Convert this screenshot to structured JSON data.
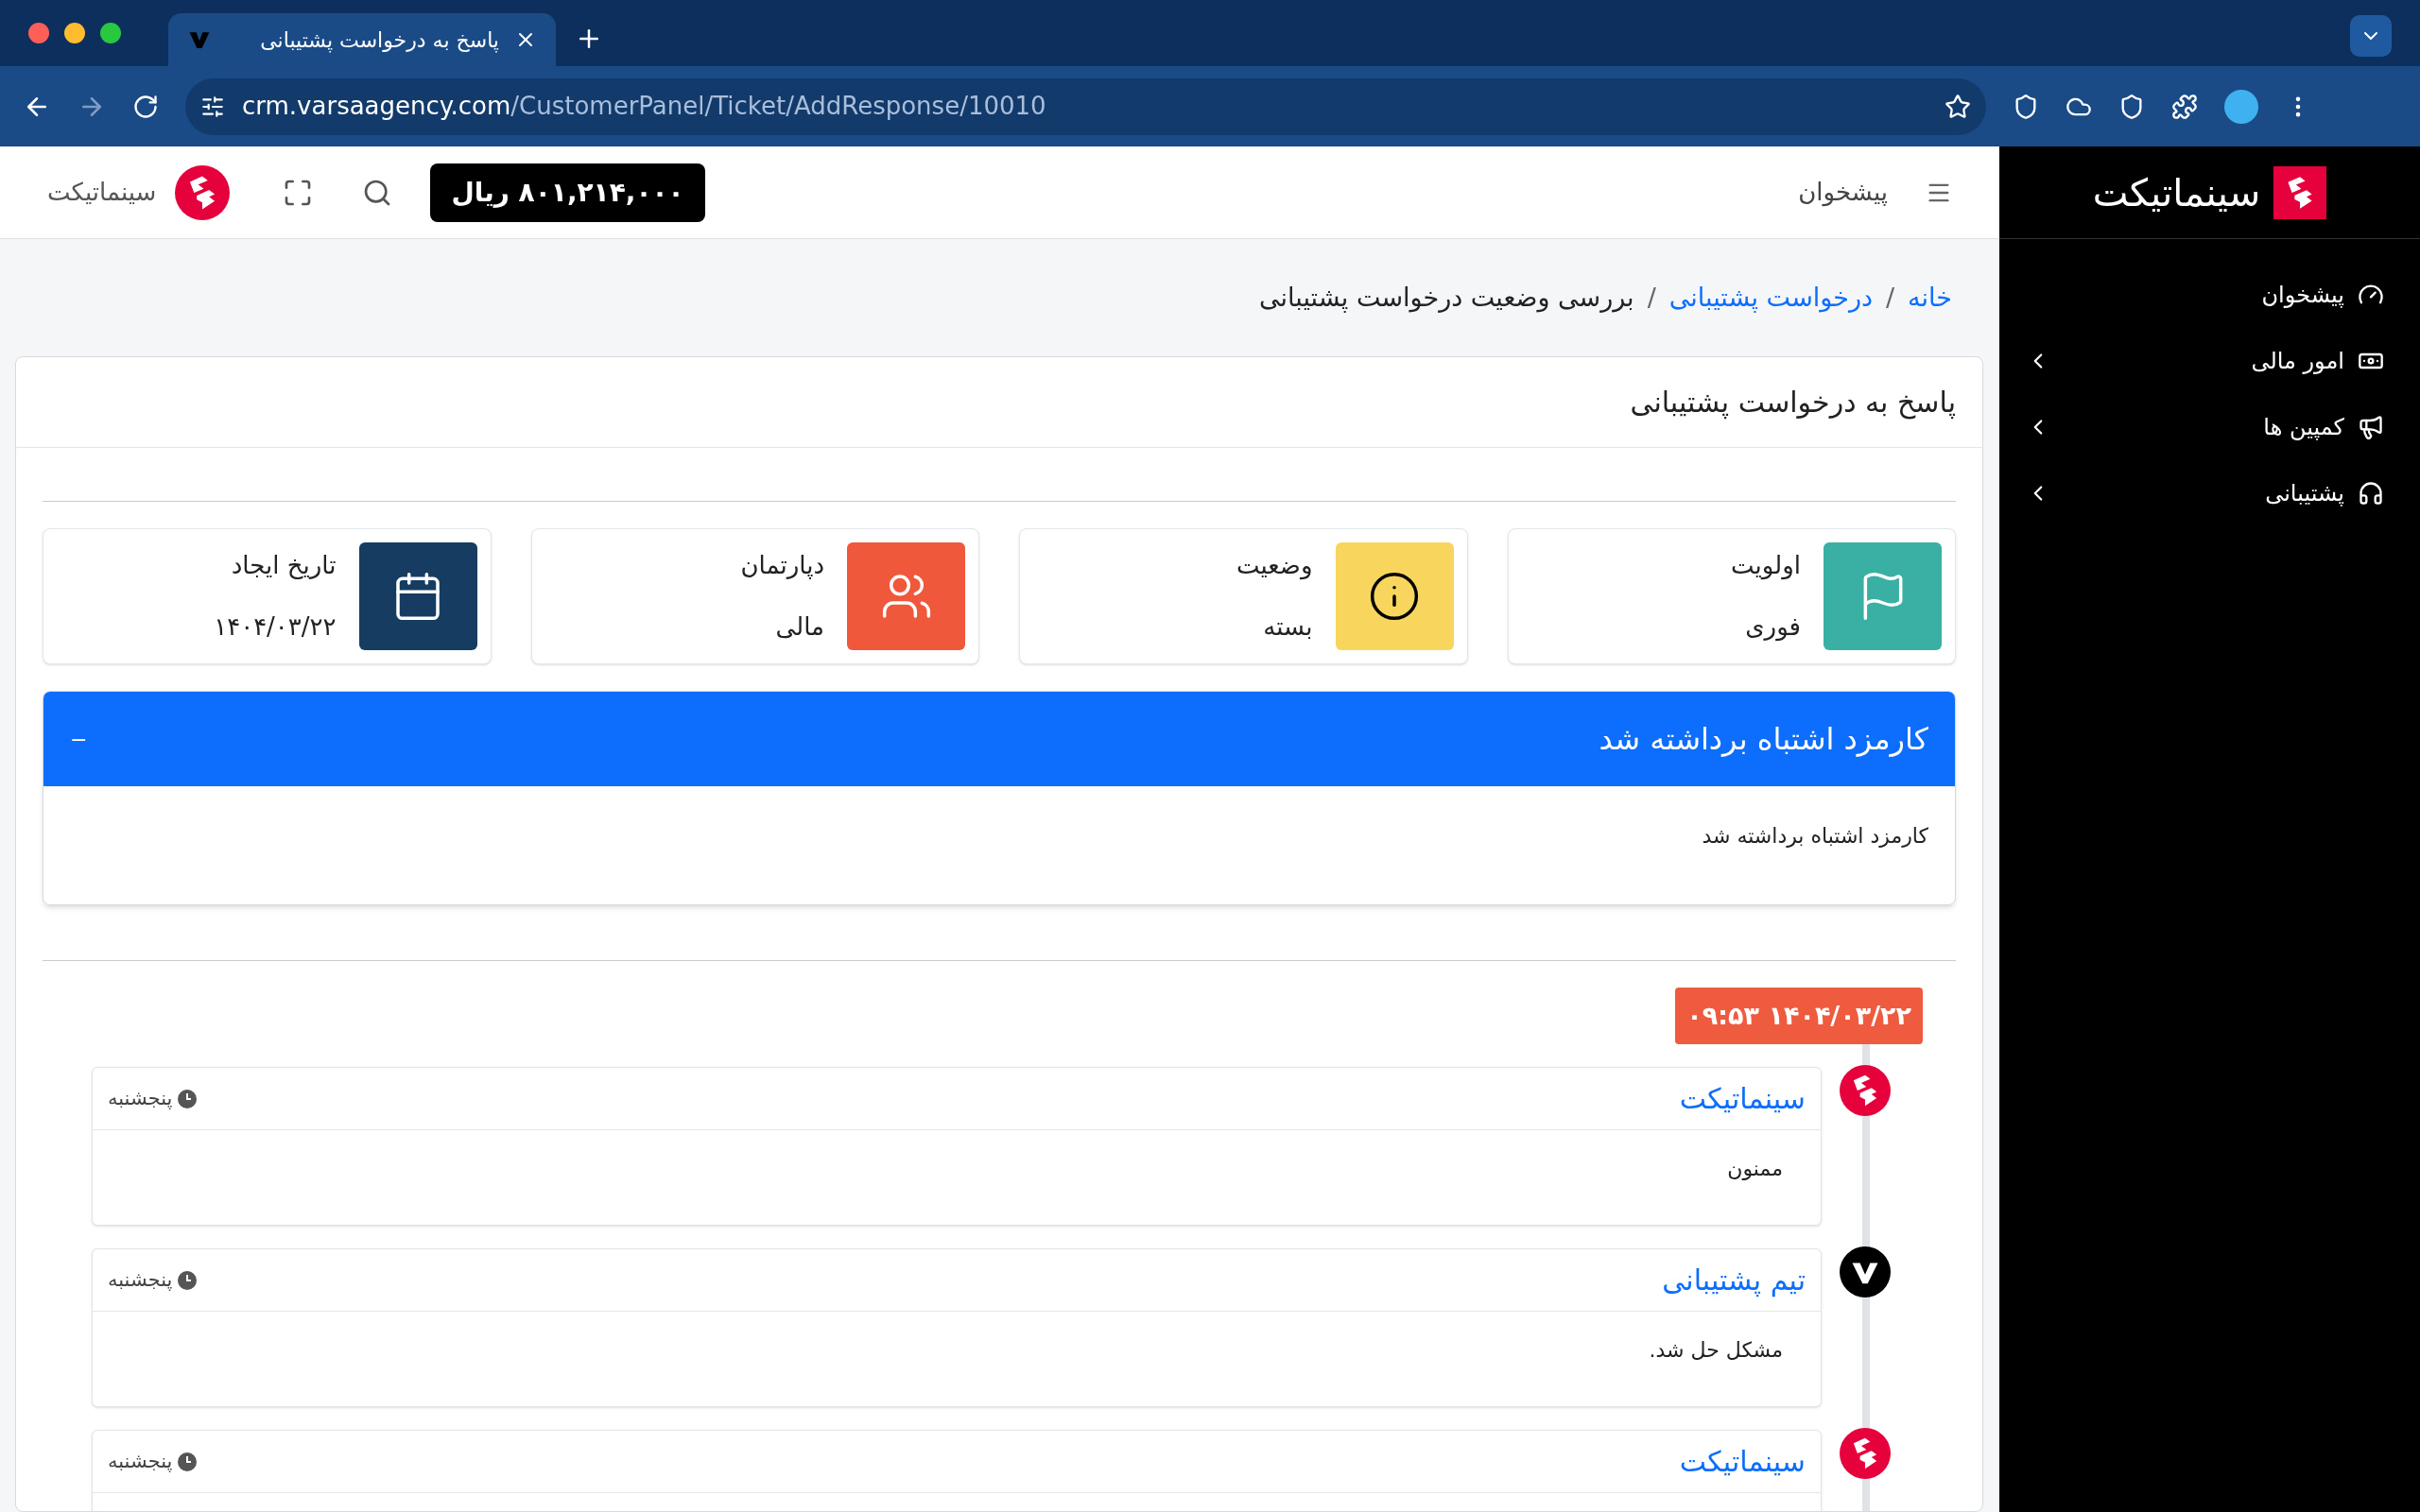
{
  "browser": {
    "tab_title": "پاسخ به درخواست پشتیبانی",
    "url_host": "crm.varsaagency.com",
    "url_path": "/CustomerPanel/Ticket/AddResponse/10010"
  },
  "sidebar": {
    "brand": "سینماتیکت",
    "items": [
      {
        "label": "پیشخوان",
        "has_submenu": false
      },
      {
        "label": "امور مالی",
        "has_submenu": true
      },
      {
        "label": "کمپین ها",
        "has_submenu": true
      },
      {
        "label": "پشتیبانی",
        "has_submenu": true
      }
    ]
  },
  "header": {
    "page": "پیشخوان",
    "balance": "۸۰۱,۲۱۴,۰۰۰ ریال",
    "user": "سینماتیکت"
  },
  "breadcrumb_separator": "/",
  "breadcrumb": [
    {
      "label": "خانه",
      "link": true
    },
    {
      "label": "درخواست پشتیبانی",
      "link": true
    },
    {
      "label": "بررسی وضعیت درخواست پشتیبانی",
      "link": false
    }
  ],
  "card_title": "پاسخ به درخواست پشتیبانی",
  "stats": [
    {
      "label": "اولویت",
      "value": "فوری",
      "color": "#3aafa4"
    },
    {
      "label": "وضعیت",
      "value": "بسته",
      "color": "#f8d65e"
    },
    {
      "label": "دپارتمان",
      "value": "مالی",
      "color": "#ef583b"
    },
    {
      "label": "تاریخ ایجاد",
      "value": "۱۴۰۴/۰۳/۲۲",
      "color": "#163d61"
    }
  ],
  "ticket": {
    "subject": "کارمزد اشتباه برداشته شد",
    "collapse_sign": "−",
    "expanded": true,
    "body": "کارمزد اشتباه برداشته شد"
  },
  "timeline": {
    "date": "۱۴۰۴/۰۳/۲۲ ۰۹:۵۳",
    "entries": [
      {
        "author": "سینماتیکت",
        "day": "پنجشنبه",
        "kind": "brand",
        "body": "ممنون"
      },
      {
        "author": "تیم پشتیبانی",
        "day": "پنجشنبه",
        "kind": "team",
        "body": "مشکل حل شد."
      },
      {
        "author": "سینماتیکت",
        "day": "پنجشنبه",
        "kind": "brand"
      }
    ]
  }
}
